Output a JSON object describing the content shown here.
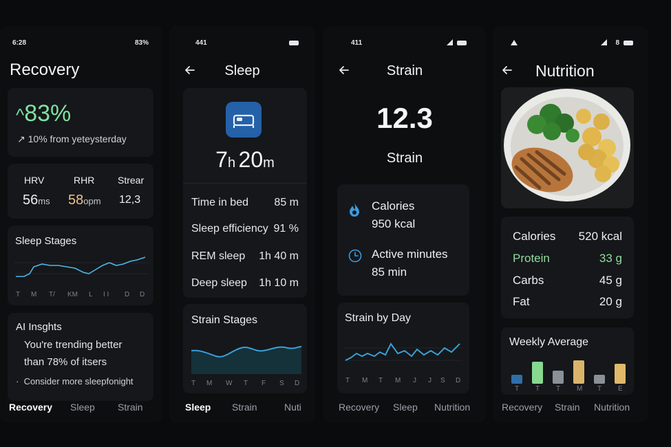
{
  "recovery": {
    "status": {
      "time": "6:28",
      "battery": "83%"
    },
    "title": "Recovery",
    "score": {
      "arrow": "^",
      "value": "83%",
      "trend": "10% from yeteysterday"
    },
    "metrics": [
      {
        "label": "HRV",
        "value": "56",
        "unit": "ms"
      },
      {
        "label": "RHR",
        "value": "58",
        "unit": "opm"
      },
      {
        "label": "Strear",
        "value": "12,3",
        "unit": ""
      }
    ],
    "sleep_stages": {
      "title": "Sleep Stages",
      "days": [
        "T",
        "M",
        "T/",
        "KM",
        "L",
        "I I",
        "D",
        "D"
      ]
    },
    "insights": {
      "title": "AI Insghts",
      "line1": "You're trending better",
      "line2": "than 78% of itsers",
      "bullet": "Consider more sleepfonight"
    },
    "tabs": [
      "Recovery",
      "Sleep",
      "Strain"
    ],
    "colors": {
      "accent_green": "#7fe0a0",
      "accent_orange": "#f2c28a",
      "line_blue": "#4fb7e8"
    }
  },
  "sleep": {
    "status": {
      "time": "441"
    },
    "title": "Sleep",
    "duration": {
      "h": "7",
      "h_unit": "h",
      "m": "20",
      "m_unit": "m"
    },
    "stats": [
      {
        "label": "Time in bed",
        "value": "85 m"
      },
      {
        "label": "Sleep efficiency",
        "value": "91 %"
      },
      {
        "label": "REM sleep",
        "value": "1h 40 m"
      },
      {
        "label": "Deep sleep",
        "value": "1h 10 m"
      }
    ],
    "strain_stages": {
      "title": "Strain Stages",
      "days": [
        "T",
        "M",
        "W",
        "T",
        "F",
        "S",
        "D"
      ]
    },
    "tabs": [
      "Sleep",
      "Strain",
      "Nuti"
    ],
    "icon": "bed-icon"
  },
  "strain": {
    "status": {
      "time": "411"
    },
    "title": "Strain",
    "score": {
      "value": "12.3",
      "label": "Strain"
    },
    "calories": {
      "label": "Calories",
      "value": "950 kcal",
      "icon": "flame-icon"
    },
    "active": {
      "label": "Active minutes",
      "value": "85 min",
      "icon": "clock-icon"
    },
    "by_day": {
      "title": "Strain by Day",
      "days": [
        "T",
        "M",
        "T",
        "M",
        "J",
        "J",
        "S",
        "D"
      ]
    },
    "tabs": [
      "Recovery",
      "Sleep",
      "Nutrition"
    ]
  },
  "nutrition": {
    "status": {
      "signal": "8"
    },
    "title": "Nutrition",
    "macros": [
      {
        "label": "Calories",
        "value": "520",
        "unit": "kcal"
      },
      {
        "label": "Protein",
        "value": "33",
        "unit": "g"
      },
      {
        "label": "Carbs",
        "value": "45",
        "unit": "g"
      },
      {
        "label": "Fat",
        "value": "20",
        "unit": "g"
      }
    ],
    "weekly": {
      "title": "Weekly Average",
      "days": [
        "T",
        "T",
        "T",
        "M",
        "T",
        "E"
      ],
      "levels": [
        0.35,
        0.85,
        0.5,
        0.9,
        0.35,
        0.75
      ],
      "colors": [
        "#2f6fa8",
        "#86d98f",
        "#8a9097",
        "#d9b56a",
        "#8a9097",
        "#e0b86a"
      ]
    },
    "tabs": [
      "Recovery",
      "Strain",
      "Nutrition"
    ]
  }
}
